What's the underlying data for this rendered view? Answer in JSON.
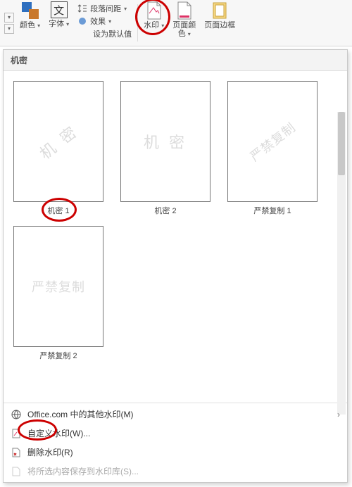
{
  "ribbon": {
    "color_label": "颜色",
    "font_label": "字体",
    "paragraph_spacing": "段落间距",
    "effects": "效果",
    "set_default": "设为默认值",
    "watermark_label": "水印",
    "page_color_label": "页面颜\n色",
    "page_border_label": "页面边框"
  },
  "panel": {
    "section_title": "机密",
    "items": [
      {
        "wm": "机 密",
        "label": "机密 1",
        "rotated": true
      },
      {
        "wm": "机 密",
        "label": "机密 2",
        "rotated": false
      },
      {
        "wm": "严禁复制",
        "label": "严禁复制 1",
        "rotated": true
      },
      {
        "wm": "严禁复制",
        "label": "严禁复制 2",
        "rotated": false
      }
    ],
    "footer": {
      "more": "Office.com 中的其他水印(M)",
      "custom": "自定义水印(W)...",
      "remove": "删除水印(R)",
      "save": "将所选内容保存到水印库(S)..."
    }
  }
}
